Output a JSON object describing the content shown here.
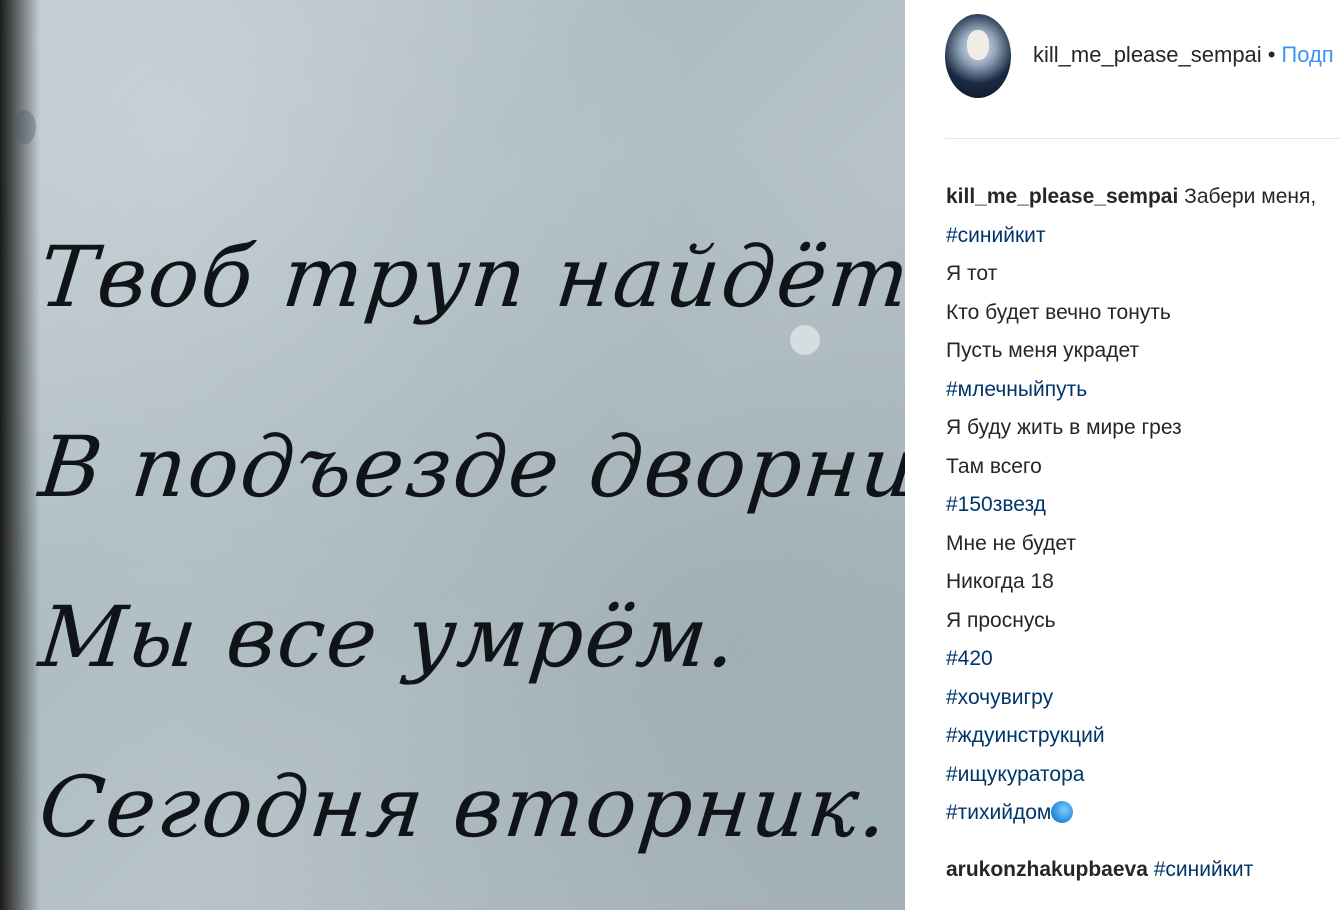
{
  "photo": {
    "lines": [
      "Твоб труп найдёт",
      "В подъезде дворник",
      "Мы все умрём.",
      "Сегодня вторник."
    ]
  },
  "post_header": {
    "username": "kill_me_please_sempai",
    "separator": "•",
    "follow_label": "Подп"
  },
  "caption": {
    "username": "kill_me_please_sempai",
    "first_text": "Забери меня,",
    "lines": [
      {
        "text": "#синийкит",
        "tag": true
      },
      {
        "text": "Я тот",
        "tag": false
      },
      {
        "text": "Кто будет вечно тонуть",
        "tag": false
      },
      {
        "text": "Пусть меня украдет",
        "tag": false
      },
      {
        "text": "#млечныйпуть",
        "tag": true
      },
      {
        "text": "Я буду жить в мире грез",
        "tag": false
      },
      {
        "text": "Там всего",
        "tag": false
      },
      {
        "text": "#150звезд",
        "tag": true
      },
      {
        "text": "Мне не будет",
        "tag": false
      },
      {
        "text": "Никогда 18",
        "tag": false
      },
      {
        "text": "Я проснусь",
        "tag": false
      },
      {
        "text": "#420",
        "tag": true
      },
      {
        "text": "#хочувигру",
        "tag": true
      },
      {
        "text": "#ждуинструкций",
        "tag": true
      },
      {
        "text": "#ищукуратора",
        "tag": true
      },
      {
        "text": "#тихийдом",
        "tag": true
      }
    ],
    "last_emoji": "whale-emoji-icon"
  },
  "comment": {
    "username": "arukonzhakupbaeva",
    "text": "#синийкит"
  },
  "colors": {
    "hashtag": "#003569",
    "follow": "#3897f0",
    "text": "#262626"
  }
}
